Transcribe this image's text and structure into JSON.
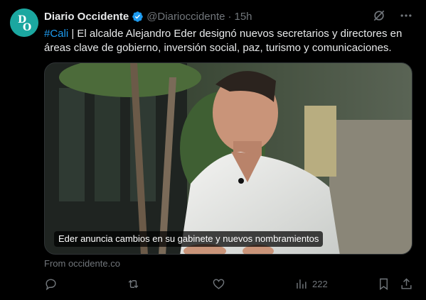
{
  "author": {
    "display_name": "Diario Occidente",
    "handle": "@Diarioccidente",
    "separator": "·",
    "time": "15h",
    "verified": true,
    "avatar_text": "DO",
    "avatar_color": "#1ba7a0"
  },
  "tweet": {
    "hashtag": "#Cali",
    "text": " | El alcalde Alejandro Eder designó nuevos secretarios y directores en áreas clave de gobierno, inversión social, paz, turismo y comunicaciones."
  },
  "media": {
    "caption": "Eder anuncia cambios en su gabinete y nuevos nombramientos"
  },
  "source": "From occidente.co",
  "actions": {
    "views": "222"
  },
  "colors": {
    "background": "#000000",
    "text": "#e7e9ea",
    "muted": "#71767b",
    "accent": "#1d9bf0"
  }
}
